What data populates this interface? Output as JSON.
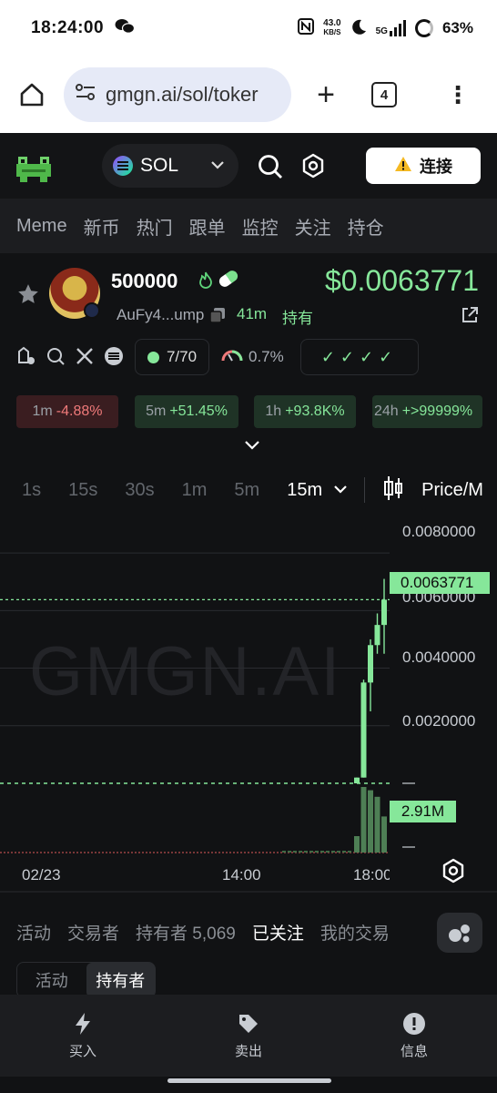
{
  "status_bar": {
    "time": "18:24:00",
    "net_speed_value": "43.0",
    "net_speed_unit": "KB/S",
    "network": "5G",
    "battery": "63%"
  },
  "browser": {
    "url": "gmgn.ai/sol/toker",
    "tab_count": "4"
  },
  "header": {
    "chain": "SOL",
    "connect_label": "连接"
  },
  "nav_tabs": [
    "Meme",
    "新币",
    "热门",
    "跟单",
    "监控",
    "关注",
    "持仓"
  ],
  "token": {
    "name": "500000",
    "price": "$0.0063771",
    "address": "AuFy4...ump",
    "age": "41m",
    "holding_label": "持有",
    "holders_ratio": "7/70",
    "top_pct": "0.7%",
    "checks": "✓✓✓✓",
    "changes": [
      {
        "period": "1m",
        "value": "-4.88%",
        "direction": "neg"
      },
      {
        "period": "5m",
        "value": "+51.45%",
        "direction": "pos"
      },
      {
        "period": "1h",
        "value": "+93.8K%",
        "direction": "pos"
      },
      {
        "period": "24h",
        "value": "+>99999%",
        "direction": "pos"
      }
    ]
  },
  "timeframes": {
    "options": [
      "1s",
      "15s",
      "30s",
      "1m",
      "5m",
      "15m"
    ],
    "active": "15m",
    "price_tab": "Price/M"
  },
  "chart": {
    "watermark": "GMGN.AI",
    "y_ticks": [
      "0.0080000",
      "0.0060000",
      "0.0040000",
      "0.0020000"
    ],
    "current_price": "0.0063771",
    "volume_label": "2.91M",
    "x_ticks": [
      "02/23",
      "14:00",
      "18:00"
    ]
  },
  "chart_data": {
    "type": "candlestick",
    "ylim": [
      0,
      0.0093
    ],
    "y_ticks": [
      0.002,
      0.004,
      0.006,
      0.008
    ],
    "x_ticks": [
      "02/23",
      "14:00",
      "18:00"
    ],
    "last_price": 0.0063771,
    "last_volume": "2.91M",
    "candles": [
      {
        "o": 0.0,
        "h": 0.0002,
        "l": 0.0,
        "c": 0.0002
      },
      {
        "o": 0.0002,
        "h": 0.0036,
        "l": 0.0002,
        "c": 0.0035
      },
      {
        "o": 0.0035,
        "h": 0.005,
        "l": 0.0025,
        "c": 0.0048
      },
      {
        "o": 0.0048,
        "h": 0.0059,
        "l": 0.0045,
        "c": 0.0055
      },
      {
        "o": 0.0055,
        "h": 0.0071,
        "l": 0.0045,
        "c": 0.0063771
      }
    ]
  },
  "bottom_tabs": [
    "活动",
    "交易者",
    "持有者 5,069",
    "已关注",
    "我的交易"
  ],
  "bottom_tabs_active": "已关注",
  "segments": [
    "活动",
    "持有者"
  ],
  "segments_active": "持有者",
  "actions": [
    "买入",
    "卖出",
    "信息"
  ]
}
